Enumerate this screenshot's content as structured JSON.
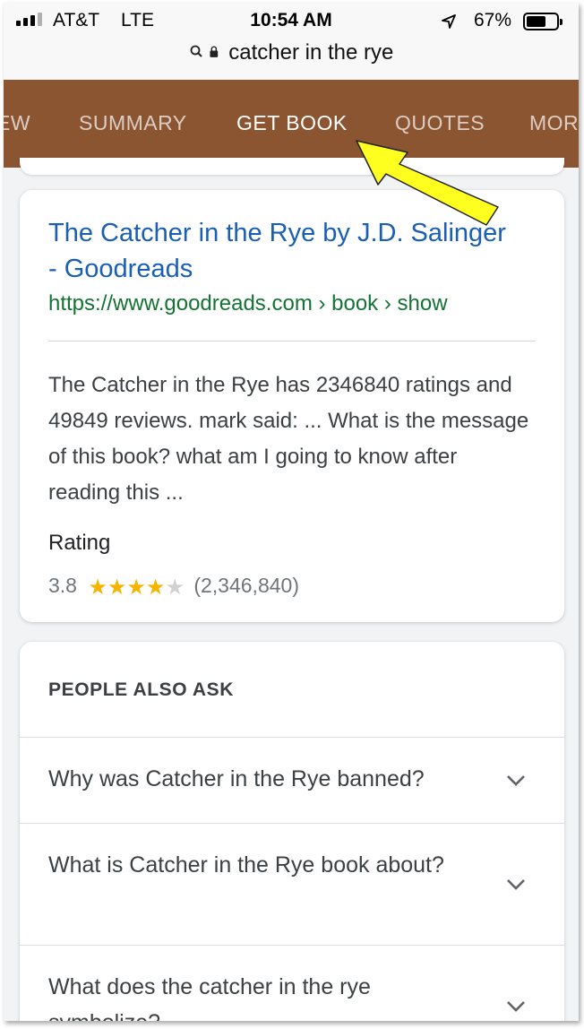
{
  "status_bar": {
    "carrier": "AT&T",
    "network": "LTE",
    "time": "10:54 AM",
    "battery_percent": "67%",
    "battery_level": 0.67,
    "icons": [
      "signal-bars-icon",
      "location-arrow-icon",
      "battery-icon"
    ]
  },
  "address_bar": {
    "query": "catcher in the rye",
    "icons": [
      "search-icon",
      "lock-icon"
    ]
  },
  "tabs": [
    {
      "label": "EW",
      "active": false
    },
    {
      "label": "SUMMARY",
      "active": false
    },
    {
      "label": "GET BOOK",
      "active": true
    },
    {
      "label": "QUOTES",
      "active": false
    },
    {
      "label": "MOR",
      "active": false
    }
  ],
  "colors": {
    "tab_bar": "#8b5532",
    "link": "#1a5fb4",
    "url": "#137333",
    "star": "#f6b400",
    "annotation_arrow": "#ffff1f"
  },
  "result": {
    "title": "The Catcher in the Rye by J.D. Salinger - Goodreads",
    "url": "https://www.goodreads.com › book › show",
    "snippet": "The Catcher in the Rye has 2346840 ratings and 49849 reviews. mark said: ... What is the message of this book? what am I going to know after reading this ...",
    "rating_label": "Rating",
    "rating_value": "3.8",
    "stars_filled": 4,
    "stars_total": 5,
    "rating_count": "(2,346,840)"
  },
  "people_also_ask": {
    "heading": "PEOPLE ALSO ASK",
    "questions": [
      "Why was Catcher in the Rye banned?",
      "What is Catcher in the Rye book about?",
      "What does the catcher in the rye symbolize?"
    ]
  }
}
